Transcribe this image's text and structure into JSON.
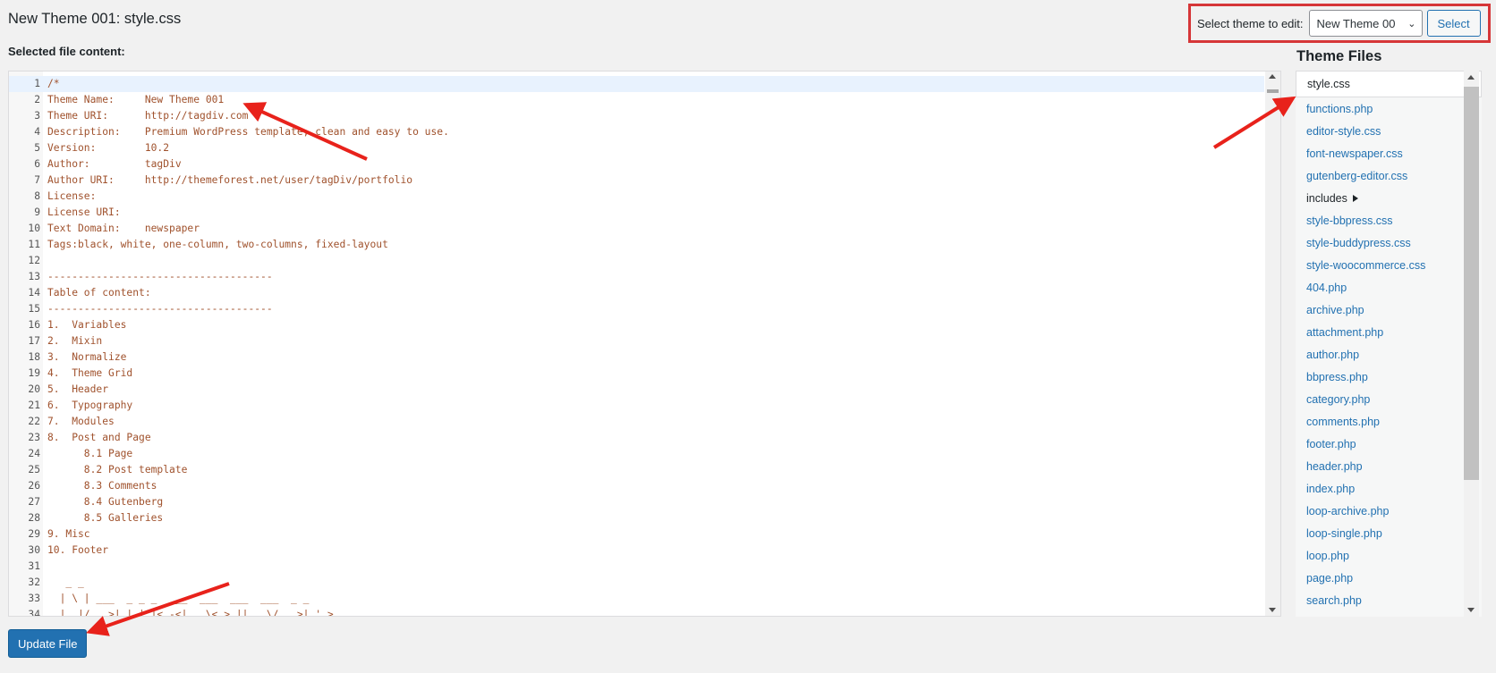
{
  "header": {
    "title": "New Theme 001: style.css",
    "file_content_label": "Selected file content:"
  },
  "theme_selector": {
    "label": "Select theme to edit:",
    "selected": "New Theme 00",
    "button": "Select"
  },
  "editor": {
    "active_line": 1,
    "lines": [
      "/*",
      "Theme Name:     New Theme 001",
      "Theme URI:      http://tagdiv.com",
      "Description:    Premium WordPress template, clean and easy to use.",
      "Version:        10.2",
      "Author:         tagDiv",
      "Author URI:     http://themeforest.net/user/tagDiv/portfolio",
      "License:",
      "License URI:",
      "Text Domain:    newspaper",
      "Tags:black, white, one-column, two-columns, fixed-layout",
      "",
      "-------------------------------------",
      "Table of content:",
      "-------------------------------------",
      "1.  Variables",
      "2.  Mixin",
      "3.  Normalize",
      "4.  Theme Grid",
      "5.  Header",
      "6.  Typography",
      "7.  Modules",
      "8.  Post and Page",
      "      8.1 Page",
      "      8.2 Post template",
      "      8.3 Comments",
      "      8.4 Gutenberg",
      "      8.5 Galleries",
      "9. Misc",
      "10. Footer",
      "",
      "   _ _",
      "  | \\ | ___  _ _ _  ___  ___  ___  ___  _ _",
      "  |  |/ . >| | | |< -<| . \\< > || . \\/ . >| ' >"
    ]
  },
  "files": {
    "heading": "Theme Files",
    "items": [
      {
        "label": "style.css",
        "state": "selected"
      },
      {
        "label": "functions.php"
      },
      {
        "label": "editor-style.css"
      },
      {
        "label": "font-newspaper.css"
      },
      {
        "label": "gutenberg-editor.css"
      },
      {
        "label": "includes",
        "state": "folder"
      },
      {
        "label": "style-bbpress.css"
      },
      {
        "label": "style-buddypress.css"
      },
      {
        "label": "style-woocommerce.css"
      },
      {
        "label": "404.php"
      },
      {
        "label": "archive.php"
      },
      {
        "label": "attachment.php"
      },
      {
        "label": "author.php"
      },
      {
        "label": "bbpress.php"
      },
      {
        "label": "category.php"
      },
      {
        "label": "comments.php"
      },
      {
        "label": "footer.php"
      },
      {
        "label": "header.php"
      },
      {
        "label": "index.php"
      },
      {
        "label": "loop-archive.php"
      },
      {
        "label": "loop-single.php"
      },
      {
        "label": "loop.php"
      },
      {
        "label": "page.php"
      },
      {
        "label": "search.php"
      }
    ]
  },
  "actions": {
    "update": "Update File"
  },
  "colors": {
    "annotation": "#e8221b",
    "primary": "#2271b1",
    "code_text": "#a0522d"
  }
}
